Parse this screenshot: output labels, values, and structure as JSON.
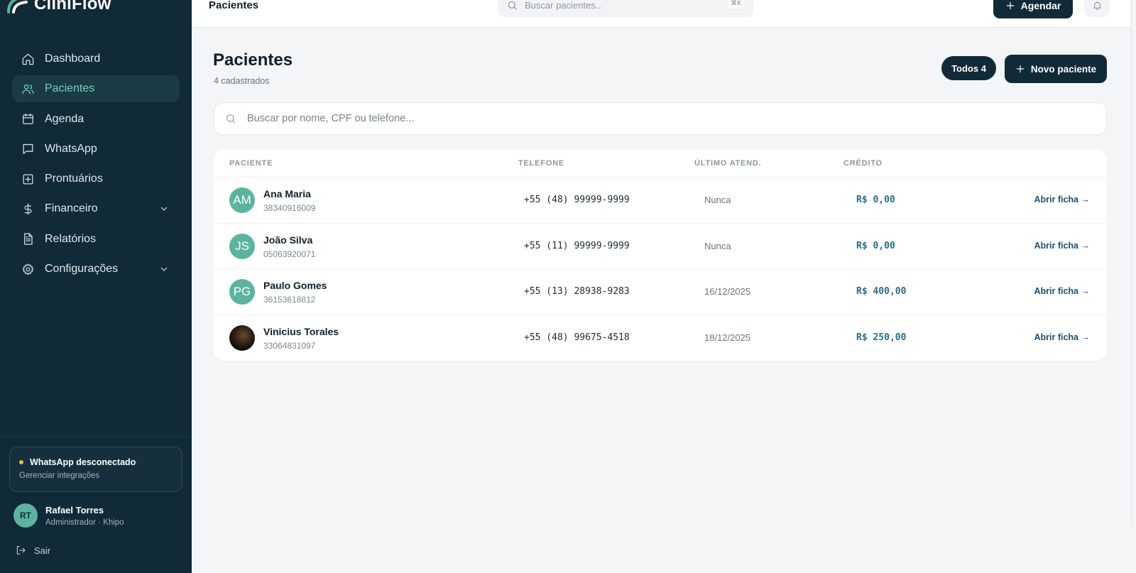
{
  "app": {
    "name": "CliniFlow"
  },
  "sidebar": {
    "items": [
      {
        "label": "Dashboard",
        "icon": "home-icon"
      },
      {
        "label": "Pacientes",
        "icon": "users-icon",
        "active": true
      },
      {
        "label": "Agenda",
        "icon": "calendar-icon"
      },
      {
        "label": "WhatsApp",
        "icon": "message-icon"
      },
      {
        "label": "Prontuários",
        "icon": "medical-plus-icon"
      },
      {
        "label": "Financeiro",
        "icon": "dollar-icon",
        "expandable": true
      },
      {
        "label": "Relatórios",
        "icon": "file-text-icon"
      },
      {
        "label": "Configurações",
        "icon": "gear-icon",
        "expandable": true
      }
    ],
    "whatsapp_status": {
      "title": "WhatsApp desconectado",
      "subtitle": "Gerenciar integrações",
      "dot_color": "#e6b84e"
    },
    "user": {
      "initials": "RT",
      "name": "Rafael Torres",
      "role": "Administrador · Khipo"
    },
    "logout_label": "Sair"
  },
  "topbar": {
    "title": "Pacientes",
    "search_placeholder": "Buscar pacientes...",
    "shortcut": "⌘K",
    "schedule_button": "Agendar"
  },
  "page": {
    "title": "Pacientes",
    "subtitle": "4 cadastrados",
    "filter_button": "Todos 4",
    "new_button": "Novo paciente",
    "search_placeholder": "Buscar por nome, CPF ou telefone..."
  },
  "table": {
    "columns": [
      "PACIENTE",
      "TELEFONE",
      "ÚLTIMO ATEND.",
      "CRÉDITO"
    ],
    "open_label": "Abrir ficha →",
    "rows": [
      {
        "initials": "AM",
        "name": "Ana Maria",
        "cpf": "38340916009",
        "phone": "+55 (48) 99999-9999",
        "last_visit": "Nunca",
        "credit": "R$ 0,00",
        "photo": false
      },
      {
        "initials": "JS",
        "name": "João Silva",
        "cpf": "05063920071",
        "phone": "+55 (11) 99999-9999",
        "last_visit": "Nunca",
        "credit": "R$ 0,00",
        "photo": false
      },
      {
        "initials": "PG",
        "name": "Paulo Gomes",
        "cpf": "36153618812",
        "phone": "+55 (13) 28938-9283",
        "last_visit": "16/12/2025",
        "credit": "R$ 400,00",
        "photo": false
      },
      {
        "initials": "",
        "name": "Vinicius Torales",
        "cpf": "33064831097",
        "phone": "+55 (48) 99675-4518",
        "last_visit": "18/12/2025",
        "credit": "R$ 250,00",
        "photo": true
      }
    ]
  },
  "colors": {
    "sidebar_bg": "#112a37",
    "accent": "#6fd3b9",
    "avatar": "#5bb49f",
    "primary_button": "#112a37",
    "credit_text": "#2a6a8a"
  }
}
